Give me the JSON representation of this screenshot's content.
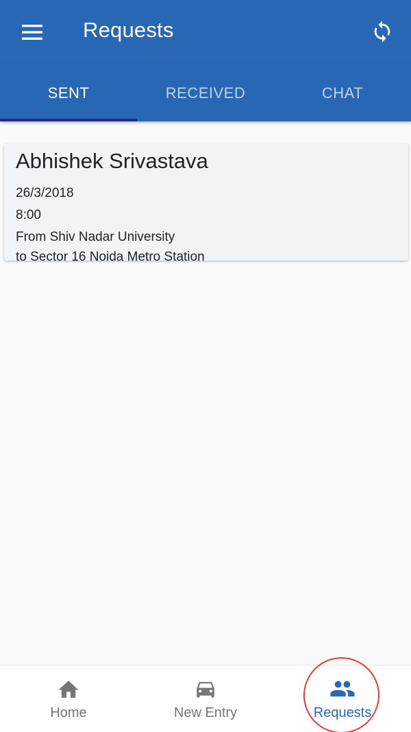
{
  "app_bar": {
    "title": "Requests",
    "menu_icon": "menu-icon",
    "refresh_icon": "refresh-icon",
    "color": "#2767b3"
  },
  "tabs": [
    {
      "label": "SENT",
      "active": true
    },
    {
      "label": "RECEIVED",
      "active": false
    },
    {
      "label": "CHAT",
      "active": false
    }
  ],
  "requests": [
    {
      "name": "Abhishek Srivastava",
      "date": "26/3/2018",
      "time": "8:00",
      "from": "From Shiv Nadar University",
      "to": "to Sector 16 Noida Metro Station"
    }
  ],
  "bottom_nav": [
    {
      "label": "Home",
      "icon": "home-icon",
      "active": false
    },
    {
      "label": "New Entry",
      "icon": "car-icon",
      "active": false
    },
    {
      "label": "Requests",
      "icon": "people-icon",
      "active": true
    }
  ],
  "highlight_color": "#e53935"
}
